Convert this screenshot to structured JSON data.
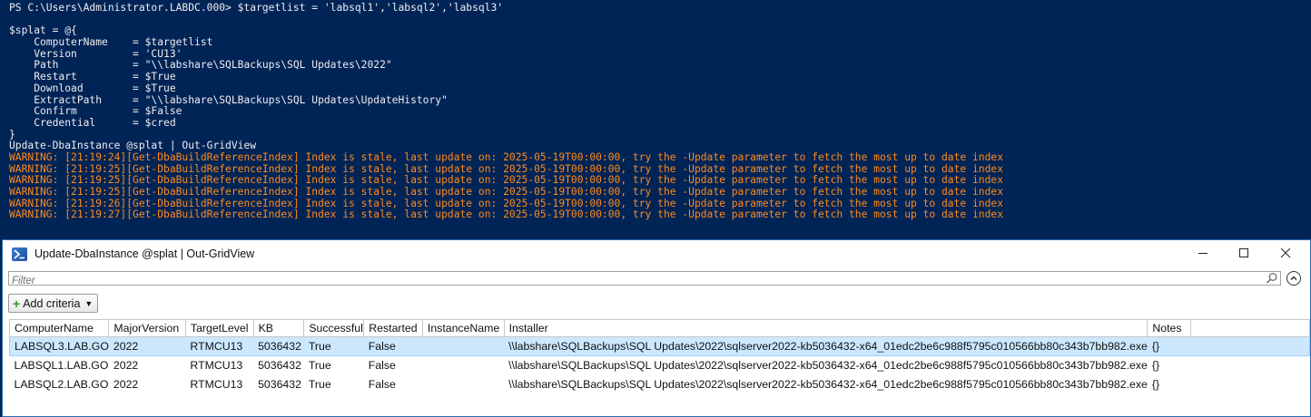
{
  "console": {
    "lines": [
      {
        "type": "out",
        "text": "PS C:\\Users\\Administrator.LABDC.000> $targetlist = 'labsql1','labsql2','labsql3'"
      },
      {
        "type": "blank",
        "text": ""
      },
      {
        "type": "out",
        "text": "$splat = @{"
      },
      {
        "type": "out",
        "text": "    ComputerName    = $targetlist"
      },
      {
        "type": "out",
        "text": "    Version         = 'CU13'"
      },
      {
        "type": "out",
        "text": "    Path            = \"\\\\labshare\\SQLBackups\\SQL Updates\\2022\""
      },
      {
        "type": "out",
        "text": "    Restart         = $True"
      },
      {
        "type": "out",
        "text": "    Download        = $True"
      },
      {
        "type": "out",
        "text": "    ExtractPath     = \"\\\\labshare\\SQLBackups\\SQL Updates\\UpdateHistory\""
      },
      {
        "type": "out",
        "text": "    Confirm         = $False"
      },
      {
        "type": "out",
        "text": "    Credential      = $cred"
      },
      {
        "type": "out",
        "text": "}"
      },
      {
        "type": "out",
        "text": "Update-DbaInstance @splat | Out-GridView"
      },
      {
        "type": "warn",
        "text": "WARNING: [21:19:24][Get-DbaBuildReferenceIndex] Index is stale, last update on: 2025-05-19T00:00:00, try the -Update parameter to fetch the most up to date index"
      },
      {
        "type": "warn",
        "text": "WARNING: [21:19:25][Get-DbaBuildReferenceIndex] Index is stale, last update on: 2025-05-19T00:00:00, try the -Update parameter to fetch the most up to date index"
      },
      {
        "type": "warn",
        "text": "WARNING: [21:19:25][Get-DbaBuildReferenceIndex] Index is stale, last update on: 2025-05-19T00:00:00, try the -Update parameter to fetch the most up to date index"
      },
      {
        "type": "warn",
        "text": "WARNING: [21:19:25][Get-DbaBuildReferenceIndex] Index is stale, last update on: 2025-05-19T00:00:00, try the -Update parameter to fetch the most up to date index"
      },
      {
        "type": "warn",
        "text": "WARNING: [21:19:26][Get-DbaBuildReferenceIndex] Index is stale, last update on: 2025-05-19T00:00:00, try the -Update parameter to fetch the most up to date index"
      },
      {
        "type": "warn",
        "text": "WARNING: [21:19:27][Get-DbaBuildReferenceIndex] Index is stale, last update on: 2025-05-19T00:00:00, try the -Update parameter to fetch the most up to date index"
      }
    ]
  },
  "gridview": {
    "title": "Update-DbaInstance @splat | Out-GridView",
    "icon": "powershell-icon",
    "filter_placeholder": "Filter",
    "filter_value": "",
    "add_criteria_label": "Add criteria",
    "columns": [
      {
        "key": "ComputerName",
        "label": "ComputerName"
      },
      {
        "key": "MajorVersion",
        "label": "MajorVersion"
      },
      {
        "key": "TargetLevel",
        "label": "TargetLevel"
      },
      {
        "key": "KB",
        "label": "KB"
      },
      {
        "key": "Successful",
        "label": "Successful"
      },
      {
        "key": "Restarted",
        "label": "Restarted"
      },
      {
        "key": "InstanceName",
        "label": "InstanceName"
      },
      {
        "key": "Installer",
        "label": "Installer"
      },
      {
        "key": "Notes",
        "label": "Notes"
      },
      {
        "key": "_filler",
        "label": ""
      }
    ],
    "rows": [
      {
        "selected": true,
        "ComputerName": "LABSQL3.LAB.GO",
        "MajorVersion": "2022",
        "TargetLevel": "RTMCU13",
        "KB": "5036432",
        "Successful": "True",
        "Restarted": "False",
        "InstanceName": "",
        "Installer": "\\\\labshare\\SQLBackups\\SQL Updates\\2022\\sqlserver2022-kb5036432-x64_01edc2be6c988f5795c010566bb80c343b7bb982.exe",
        "Notes": "{}",
        "_filler": ""
      },
      {
        "selected": false,
        "ComputerName": "LABSQL1.LAB.GO",
        "MajorVersion": "2022",
        "TargetLevel": "RTMCU13",
        "KB": "5036432",
        "Successful": "True",
        "Restarted": "False",
        "InstanceName": "",
        "Installer": "\\\\labshare\\SQLBackups\\SQL Updates\\2022\\sqlserver2022-kb5036432-x64_01edc2be6c988f5795c010566bb80c343b7bb982.exe",
        "Notes": "{}",
        "_filler": ""
      },
      {
        "selected": false,
        "ComputerName": "LABSQL2.LAB.GO",
        "MajorVersion": "2022",
        "TargetLevel": "RTMCU13",
        "KB": "5036432",
        "Successful": "True",
        "Restarted": "False",
        "InstanceName": "",
        "Installer": "\\\\labshare\\SQLBackups\\SQL Updates\\2022\\sqlserver2022-kb5036432-x64_01edc2be6c988f5795c010566bb80c343b7bb982.exe",
        "Notes": "{}",
        "_filler": ""
      }
    ]
  },
  "colors": {
    "console_bg": "#012456",
    "console_text": "#eeedf0",
    "warning_text": "#ff8a1a",
    "selection": "#cce8ff"
  }
}
